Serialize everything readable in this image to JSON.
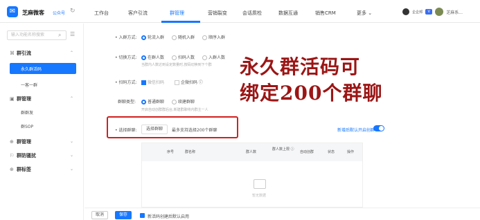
{
  "header": {
    "logo_glyph": "✉",
    "brand": "芝麻微客",
    "brand_sub": "公众号",
    "switch_icon": "↻",
    "nav": [
      "工作台",
      "客户引流",
      "群管理",
      "营销裂变",
      "会话质检",
      "数据互通",
      "销售CRM",
      "更多 ⌄"
    ],
    "user_tag": "企企邦",
    "badge": "V",
    "user_name": "芝麻系..."
  },
  "sidebar": {
    "search_placeholder": "输入功能名称搜索",
    "search_glyph": "⌕",
    "menu_glyph": "☰",
    "groups": [
      {
        "icon": "⌘",
        "label": "群引流",
        "caret": "⌃"
      },
      {
        "icon": "▣",
        "label": "群管理",
        "caret": "⌃"
      },
      {
        "icon": "⊕",
        "label": "群管理",
        "caret": "⌄"
      },
      {
        "icon": "⚐",
        "label": "群防骚扰",
        "caret": "⌄"
      },
      {
        "icon": "⊕",
        "label": "群标签",
        "caret": "⌄"
      }
    ],
    "active_item": "永久群活码",
    "sub_items": [
      "一客一群",
      "群群发",
      "群SOP"
    ]
  },
  "form": {
    "join_mode": {
      "label": "• 入群方式:",
      "options": [
        "轮流入群",
        "随机入群",
        "顺序入群"
      ]
    },
    "switch_mode": {
      "label": "• 切换方式:",
      "options": [
        "在群人数",
        "扫码人数",
        "入群人数"
      ],
      "hint": "当群内人数达到设定数量时,按码切换到下个群"
    },
    "scan_mode": {
      "label": "• 扫码方式:",
      "options": [
        "微信扫码",
        "企微扫码 ⓘ"
      ]
    },
    "group_type": {
      "label": "群聊类型:",
      "options": [
        "普通群聊",
        "续建群聊"
      ],
      "hint": "开启自动创群群后台,新建群聊将内群主一人"
    },
    "select": {
      "label": "• 选择群聊:",
      "button": "选择群聊",
      "note": "最多支持选择200个群聊"
    },
    "default_open": "新增后默认开启创群"
  },
  "overlay": {
    "line1": "永久群活码可",
    "line2": "绑定200个群聊"
  },
  "table": {
    "headers": [
      "序号",
      "群名称",
      "群人数",
      "群人数上限 ⓘ",
      "自动创群",
      "状态",
      "操作"
    ],
    "empty": "暂无数据"
  },
  "footer": {
    "cancel": "取消",
    "save": "保存",
    "checkbox_label": "新活码创建后默认启用"
  }
}
